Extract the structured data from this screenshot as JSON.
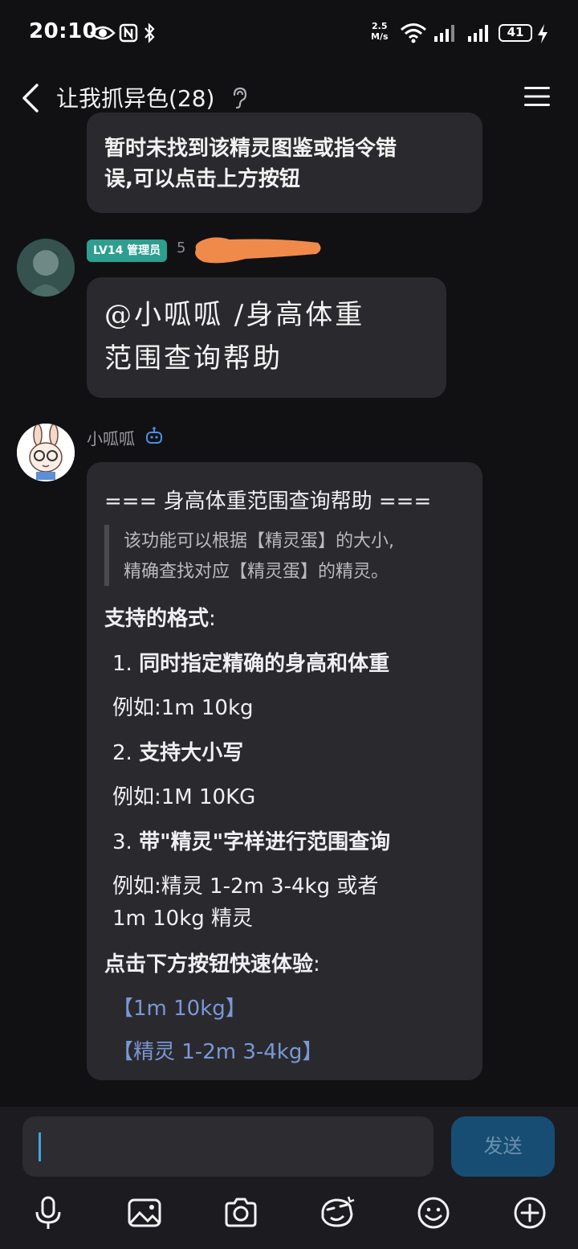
{
  "status_bar": {
    "time": "20:10",
    "net_speed_value": "2.5",
    "net_speed_unit": "M/s",
    "battery": "41"
  },
  "header": {
    "title": "让我抓异色(28)"
  },
  "messages": {
    "prev_bot_line1": "暂时未找到该精灵图鉴或指令错",
    "prev_bot_line2": "误,可以点击上方按钮",
    "user_badge": "LV14 管理员",
    "user_name_partial": "5",
    "user_msg_line1": "@小呱呱 /身高体重",
    "user_msg_line2": "范围查询帮助",
    "bot_name": "小呱呱",
    "help": {
      "title": "=== 身高体重范围查询帮助 ===",
      "quote_line1": "该功能可以根据【精灵蛋】的大小,",
      "quote_line2": "精确查找对应【精灵蛋】的精灵。",
      "formats_heading": "支持的格式",
      "item1_num": "1.",
      "item1": "同时指定精确的身高和体重",
      "example1": "例如:1m 10kg",
      "item2_num": "2.",
      "item2": "支持大小写",
      "example2": "例如:1M 10KG",
      "item3_num": "3.",
      "item3": "带\"精灵\"字样进行范围查询",
      "example3_line1": "例如:精灵 1-2m 3-4kg 或者",
      "example3_line2": "1m 10kg 精灵",
      "quick_heading": "点击下方按钮快速体验",
      "quick1": "【1m 10kg】",
      "quick2": "【精灵 1-2m 3-4kg】"
    }
  },
  "composer": {
    "send_label": "发送"
  },
  "colors": {
    "badge": "#2e9e8f",
    "link": "#7b97d6",
    "send_bg": "#174d73"
  }
}
